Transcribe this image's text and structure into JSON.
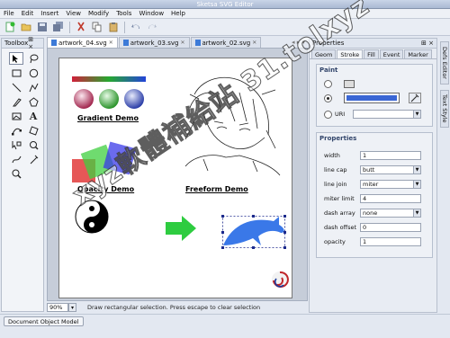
{
  "window": {
    "title": "Sketsa SVG Editor"
  },
  "menu": [
    "File",
    "Edit",
    "Insert",
    "View",
    "Modify",
    "Tools",
    "Window",
    "Help"
  ],
  "toolbar": {
    "icons": [
      "new-icon",
      "open-icon",
      "save-icon",
      "save-all-icon",
      "cut-icon",
      "copy-icon",
      "paste-icon",
      "undo-icon",
      "redo-icon"
    ]
  },
  "toolbox": {
    "title": "Toolbox",
    "controls": "⊞ ×",
    "tools": [
      "select",
      "lasso",
      "rectangle",
      "ellipse",
      "line",
      "polyline",
      "pen",
      "polygon",
      "image",
      "text",
      "node-edit",
      "rotate",
      "transform",
      "zoom-region",
      "freehand",
      "gradient",
      "zoom"
    ]
  },
  "tabs": [
    {
      "label": "artwork_04.svg",
      "active": true
    },
    {
      "label": "artwork_03.svg",
      "active": false
    },
    {
      "label": "artwork_02.svg",
      "active": false
    }
  ],
  "tab_nav": "◂ ▸ ▾",
  "canvas": {
    "labels": {
      "gradient": "Gradient Demo",
      "opacity": "Opacity Demo",
      "freeform": "Freeform Demo"
    }
  },
  "status": {
    "zoom": "90%",
    "zoom_btn": "▾",
    "message": "Draw rectangular selection. Press escape to clear selection"
  },
  "properties": {
    "title": "Properties",
    "controls": "⊞ ×",
    "tabs": [
      "Geom",
      "Stroke",
      "Fill",
      "Event",
      "Marker"
    ],
    "active_tab": "Stroke",
    "paint": {
      "title": "Paint",
      "uri_label": "URI",
      "color": "#3a66d4"
    },
    "props": {
      "title": "Properties",
      "rows": [
        {
          "label": "width",
          "value": "1",
          "kind": "field"
        },
        {
          "label": "line cap",
          "value": "butt",
          "kind": "select"
        },
        {
          "label": "line join",
          "value": "miter",
          "kind": "select"
        },
        {
          "label": "miter limit",
          "value": "4",
          "kind": "field"
        },
        {
          "label": "dash array",
          "value": "none",
          "kind": "select"
        },
        {
          "label": "dash offset",
          "value": "0",
          "kind": "field"
        },
        {
          "label": "opacity",
          "value": "1",
          "kind": "field"
        }
      ]
    }
  },
  "right_tabs": [
    "Defs Editor",
    "Text Style"
  ],
  "bottom": {
    "dom_button": "Document Object Model"
  },
  "watermark": "xyz軟體補給站 31.tolxyz"
}
